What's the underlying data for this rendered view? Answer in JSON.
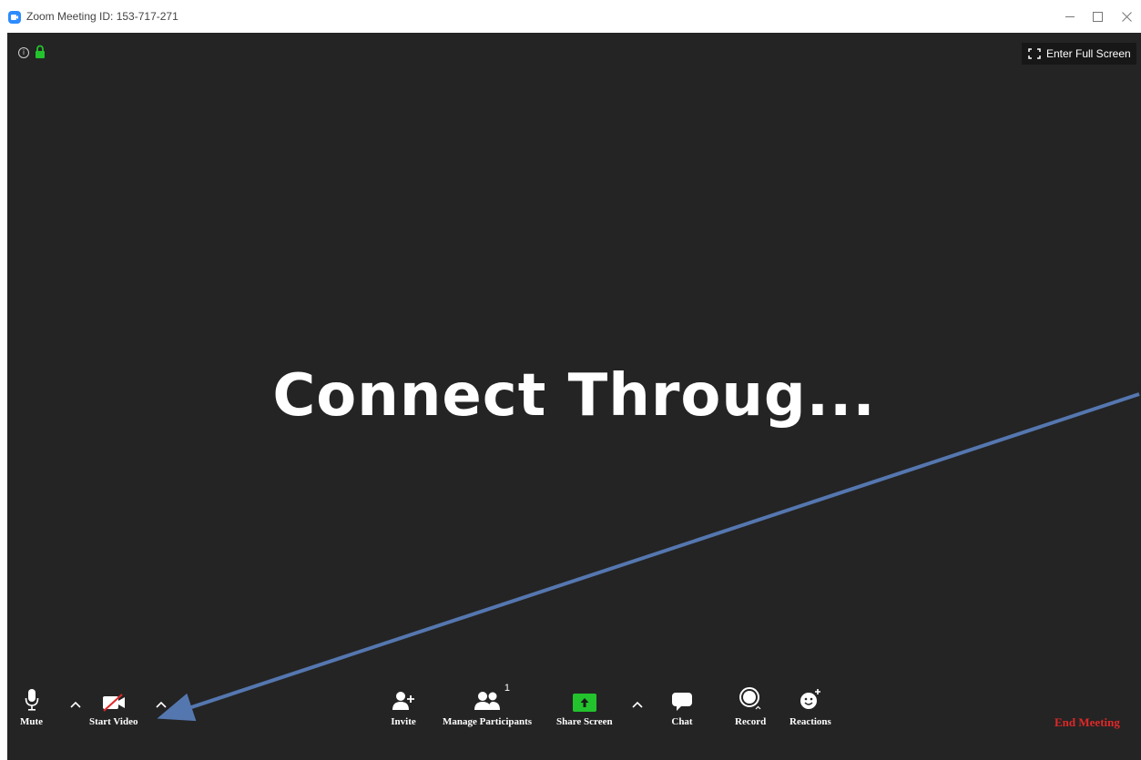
{
  "window": {
    "title": "Zoom Meeting ID: 153-717-271"
  },
  "top_bar": {
    "fullscreen_label": "Enter Full Screen"
  },
  "main": {
    "share_title": "Connect Throug..."
  },
  "toolbar": {
    "mute_label": "Mute",
    "start_video_label": "Start Video",
    "invite_label": "Invite",
    "manage_participants_label": "Manage Participants",
    "participant_count": "1",
    "share_screen_label": "Share Screen",
    "chat_label": "Chat",
    "record_label": "Record",
    "reactions_label": "Reactions",
    "end_meeting_label": "End Meeting"
  },
  "colors": {
    "meeting_background": "#242424",
    "share_green": "#23C32D",
    "end_meeting_red": "#E02828",
    "annotation_arrow": "#5577B0",
    "lock_green": "#23C32D"
  },
  "icons": [
    "zoom-app-icon",
    "info-icon",
    "lock-icon",
    "fullscreen-icon",
    "microphone-icon",
    "video-off-icon",
    "add-person-icon",
    "participants-icon",
    "share-screen-icon",
    "chat-icon",
    "record-icon",
    "reactions-icon",
    "caret-up-icon"
  ]
}
